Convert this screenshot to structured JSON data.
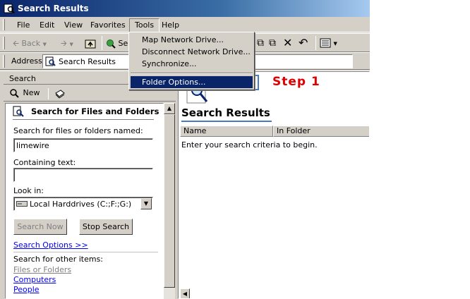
{
  "window": {
    "title": "Search Results"
  },
  "menu": [
    "File",
    "Edit",
    "View",
    "Favorites",
    "Tools",
    "Help"
  ],
  "toolbar": {
    "back_label": "Back",
    "search_label": "Se"
  },
  "address": {
    "label": "Address",
    "value": "Search Results"
  },
  "tools_menu": {
    "items": [
      "Map Network Drive...",
      "Disconnect Network Drive...",
      "Synchronize..."
    ],
    "selected_item": "Folder Options..."
  },
  "annotation": {
    "text": "Step 1",
    "color": "#e00000"
  },
  "search_pane": {
    "header": "Search",
    "new_label": "New",
    "panel_title": "Search for Files and Folders",
    "named_label": "Search for files or folders named:",
    "named_value": "limewire",
    "containing_label": "Containing text:",
    "containing_value": "",
    "lookin_label": "Look in:",
    "lookin_value": "Local Harddrives (C:;F:;G:)",
    "search_now_label": "Search Now",
    "stop_search_label": "Stop Search",
    "options_link": "Search Options >>",
    "other_items_label": "Search for other items:",
    "other_items": [
      "Files or Folders",
      "Computers",
      "People"
    ]
  },
  "results": {
    "title": "Search Results",
    "columns": [
      "Name",
      "In Folder"
    ],
    "message": "Enter your search criteria to begin."
  },
  "colors": {
    "titlebar": "#0a246a",
    "face": "#d4d0c8",
    "highlight": "#0a246a",
    "link": "#0000ff"
  }
}
